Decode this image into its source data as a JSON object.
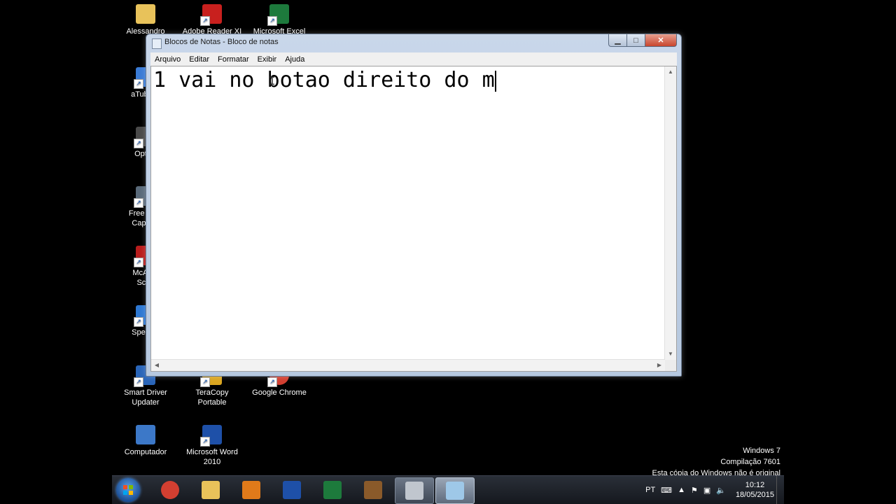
{
  "desktop": {
    "icons": [
      {
        "label": "Alessandro",
        "icon": "folder-icon",
        "color": "#e8c25a"
      },
      {
        "label": "Adobe Reader XI",
        "icon": "pdf-icon",
        "color": "#c8201e"
      },
      {
        "label": "Microsoft Excel",
        "icon": "excel-icon",
        "color": "#1d7a3c"
      },
      {
        "label": "aTube C",
        "icon": "atube-icon",
        "color": "#3a7bd5"
      },
      {
        "label": "Optimi",
        "icon": "optimizer-icon",
        "color": "#4a4a4a"
      },
      {
        "label": "Free Scre",
        "label2": "Capture",
        "icon": "screen-capture-icon",
        "color": "#5a6a7a"
      },
      {
        "label": "McAfee",
        "label2": "Scan",
        "icon": "mcafee-icon",
        "color": "#b81d1d"
      },
      {
        "label": "SpeedU",
        "icon": "speedup-icon",
        "color": "#2e78d2"
      },
      {
        "label": "Smart Driver",
        "label2": "Updater",
        "icon": "driver-icon",
        "color": "#2a65b8"
      },
      {
        "label": "TeraCopy Portable",
        "icon": "teracopy-icon",
        "color": "#d9a520"
      },
      {
        "label": "Google Chrome",
        "icon": "chrome-icon",
        "color": "#d23f31"
      },
      {
        "label": "Computador",
        "icon": "computer-icon",
        "color": "#3c78c8"
      },
      {
        "label": "Microsoft Word",
        "label2": "2010",
        "icon": "word-icon",
        "color": "#1e50a8"
      }
    ]
  },
  "notepad": {
    "title": "Blocos de Notas - Bloco de notas",
    "menu": [
      "Arquivo",
      "Editar",
      "Formatar",
      "Exibir",
      "Ajuda"
    ],
    "content": "1 vai no botao direito do m",
    "close_symbol": "✕",
    "minimize_symbol": "▁",
    "maximize_symbol": "□"
  },
  "watermark": {
    "line1": "Windows 7",
    "line2": "Compilação 7601",
    "line3": "Esta cópia do Windows não é original"
  },
  "taskbar": {
    "apps": [
      {
        "icon": "chrome-icon",
        "color": "#d23f31"
      },
      {
        "icon": "explorer-icon",
        "color": "#e8c25a"
      },
      {
        "icon": "media-player-icon",
        "color": "#e07a1a"
      },
      {
        "icon": "word-icon",
        "color": "#1e50a8"
      },
      {
        "icon": "excel-icon",
        "color": "#1d7a3c"
      },
      {
        "icon": "game-icon",
        "color": "#8a5a2a"
      },
      {
        "icon": "camera-icon",
        "color": "#c0c6ce"
      },
      {
        "icon": "notepad-icon",
        "color": "#9ec8e8"
      }
    ],
    "lang": "PT",
    "time": "10:12",
    "date": "18/05/2015"
  }
}
